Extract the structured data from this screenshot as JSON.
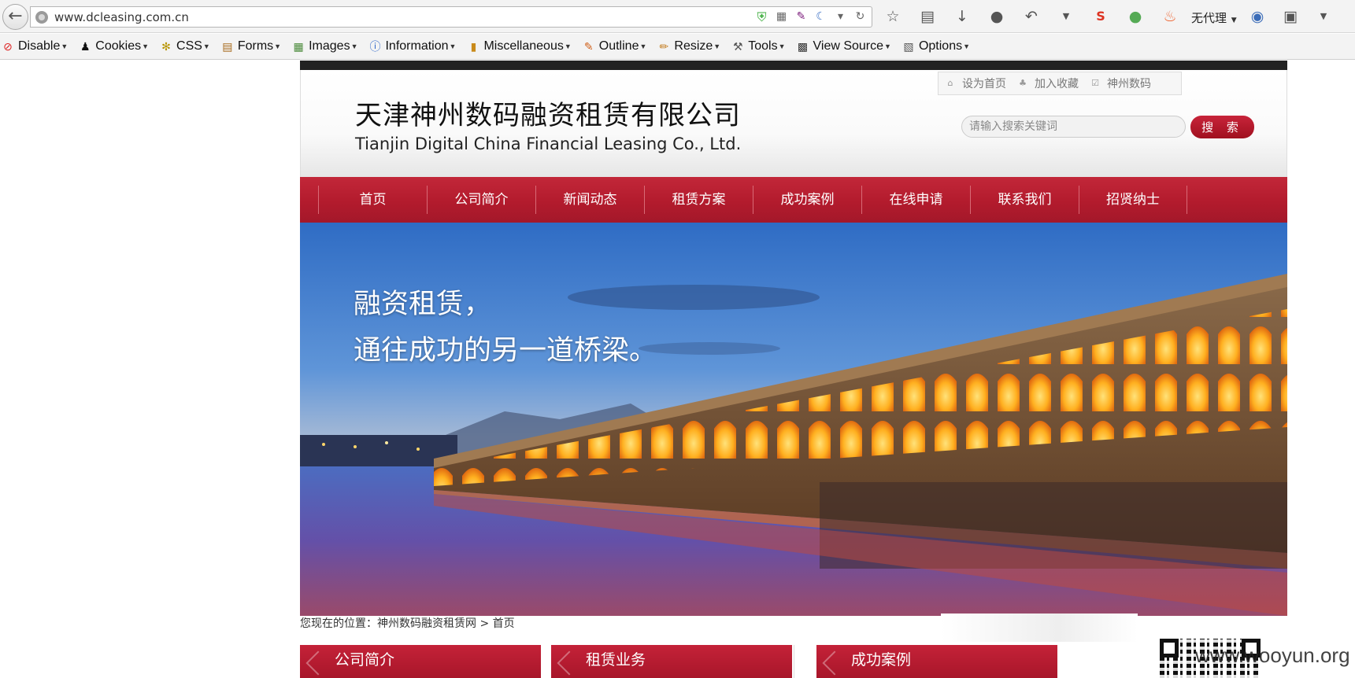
{
  "browser": {
    "url": "www.dcleasing.com.cn",
    "proxy_label": "无代理",
    "dev_toolbar": [
      {
        "label": "Disable",
        "icon": "disable-icon"
      },
      {
        "label": "Cookies",
        "icon": "cookies-icon"
      },
      {
        "label": "CSS",
        "icon": "css-icon"
      },
      {
        "label": "Forms",
        "icon": "forms-icon"
      },
      {
        "label": "Images",
        "icon": "images-icon"
      },
      {
        "label": "Information",
        "icon": "information-icon"
      },
      {
        "label": "Miscellaneous",
        "icon": "miscellaneous-icon"
      },
      {
        "label": "Outline",
        "icon": "outline-icon"
      },
      {
        "label": "Resize",
        "icon": "resize-icon"
      },
      {
        "label": "Tools",
        "icon": "tools-icon"
      },
      {
        "label": "View Source",
        "icon": "view-source-icon"
      },
      {
        "label": "Options",
        "icon": "options-icon"
      }
    ]
  },
  "site": {
    "company_name_cn": "天津神州数码融资租赁有限公司",
    "company_name_en": "Tianjin Digital China Financial Leasing Co., Ltd.",
    "quick_links": {
      "set_home": "设为首页",
      "add_favorite": "加入收藏",
      "brand": "神州数码"
    },
    "search": {
      "placeholder": "请输入搜索关键词",
      "button": "搜 索"
    },
    "nav": [
      "首页",
      "公司简介",
      "新闻动态",
      "租赁方案",
      "成功案例",
      "在线申请",
      "联系我们",
      "招贤纳士"
    ],
    "banner": {
      "line1": "融资租赁，",
      "line2": "通往成功的另一道桥梁。"
    },
    "breadcrumb": "您现在的位置：神州数码融资租赁网 > 首页",
    "sections": [
      "公司简介",
      "租赁业务",
      "成功案例"
    ],
    "watermark": "www.wooyun.org"
  },
  "colors": {
    "brand_red": "#b31b2d",
    "header_bar": "#222222"
  }
}
